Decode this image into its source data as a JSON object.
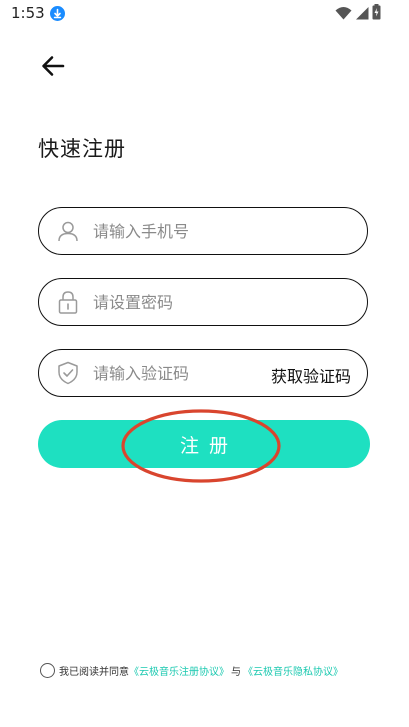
{
  "status_bar": {
    "time": "1:53",
    "download_icon": "download-icon",
    "wifi_icon": "wifi-icon",
    "signal_icon": "signal-icon",
    "battery_icon": "battery-charging-icon"
  },
  "nav": {
    "back_icon": "arrow-left-icon"
  },
  "page": {
    "title": "快速注册"
  },
  "form": {
    "phone_placeholder": "请输入手机号",
    "phone_value": "",
    "phone_icon": "user-icon",
    "password_placeholder": "请设置密码",
    "password_value": "",
    "password_icon": "lock-icon",
    "code_placeholder": "请输入验证码",
    "code_value": "",
    "code_icon": "shield-check-icon",
    "get_code_label": "获取验证码"
  },
  "register_button": {
    "label": "注册"
  },
  "agreement": {
    "prefix": "我已阅读并同意",
    "terms_link": "《云极音乐注册协议》",
    "joiner": "与",
    "privacy_link": "《云极音乐隐私协议》"
  },
  "colors": {
    "accent": "#1ee0c1",
    "link": "#1bc9b0",
    "annotation": "#d9452e"
  }
}
